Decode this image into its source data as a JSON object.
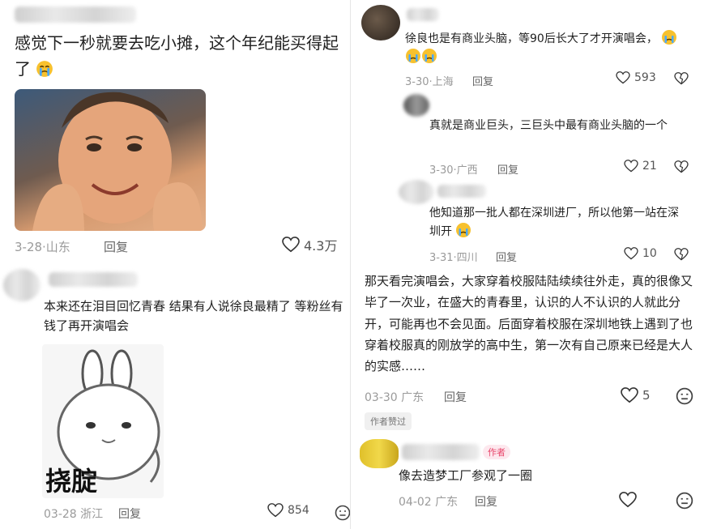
{
  "left": {
    "comment1": {
      "text": "感觉下一秒就要去吃小摊，这个年纪能买得起了",
      "meta": "3-28·山东",
      "reply": "回复",
      "likes": "4.3万"
    },
    "comment2": {
      "text": "本来还在泪目回忆青春 结果有人说徐良最精了 等粉丝有钱了再开演唱会",
      "sticker_text": "挠腚",
      "meta": "03-28 浙江",
      "reply": "回复",
      "likes": "854"
    }
  },
  "right": {
    "reply1": {
      "text": "徐良也是有商业头脑，等90后长大了才开演唱会，",
      "meta": "3-30·上海",
      "reply": "回复",
      "likes": "593"
    },
    "reply2": {
      "text": "真就是商业巨头，三巨头中最有商业头脑的一个",
      "meta": "3-30·广西",
      "reply": "回复",
      "likes": "21"
    },
    "reply3": {
      "text": "他知道那一批人都在深圳进厂，所以他第一站在深圳开",
      "meta": "3-31·四川",
      "reply": "回复",
      "likes": "10"
    },
    "comment3": {
      "text": "那天看完演唱会，大家穿着校服陆陆续续往外走，真的很像又毕了一次业，在盛大的青春里，认识的人不认识的人就此分开，可能再也不会见面。后面穿着校服在深圳地铁上遇到了也穿着校服真的刚放学的高中生，第一次有自己原来已经是大人的实感……",
      "meta": "03-30 广东",
      "reply": "回复",
      "likes": "5",
      "liked_badge": "作者赞过"
    },
    "comment4": {
      "author_badge": "作者",
      "text": "像去造梦工厂参观了一圈",
      "meta": "04-02 广东",
      "reply": "回复"
    }
  },
  "icons": {
    "heart": "heart-icon",
    "dislike": "dislike-heart-icon",
    "neutral": "neutral-face-icon",
    "crying": "crying-emoji-icon"
  },
  "colors": {
    "accent": "#e8456a",
    "meta": "#9a9a9a"
  }
}
